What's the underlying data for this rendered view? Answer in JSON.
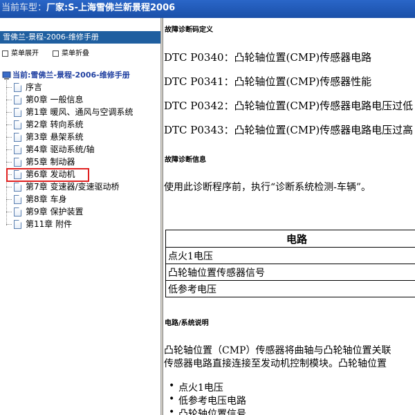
{
  "window": {
    "title_prefix": "当前车型：",
    "title_value": "厂家:S-上海雪佛兰新景程2006"
  },
  "sidebar": {
    "book_title": "雪佛兰-景程-2006-维修手册",
    "expand_label": "菜单展开",
    "collapse_label": "菜单折叠",
    "root_label": "当前:雪佛兰-景程-2006-维修手册",
    "items": [
      {
        "label": "序言"
      },
      {
        "label": "第0章  一般信息"
      },
      {
        "label": "第1章  暖风、通风与空调系统"
      },
      {
        "label": "第2章  转向系统"
      },
      {
        "label": "第3章  悬架系统"
      },
      {
        "label": "第4章  驱动系统/轴"
      },
      {
        "label": "第5章  制动器"
      },
      {
        "label": "第6章  发动机",
        "selected": true
      },
      {
        "label": "第7章  变速器/变速驱动桥"
      },
      {
        "label": "第8章  车身"
      },
      {
        "label": "第9章  保护装置"
      },
      {
        "label": "第11章  附件"
      }
    ]
  },
  "content": {
    "top_heading": "故障诊断码定义",
    "dtcs": [
      "DTC P0340：凸轮轴位置(CMP)传感器电路",
      "DTC P0341：凸轮轴位置(CMP)传感器性能",
      "DTC P0342：凸轮轴位置(CMP)传感器电路电压过低",
      "DTC P0343：凸轮轴位置(CMP)传感器电路电压过高"
    ],
    "diag_heading": "故障诊断信息",
    "diag_text": "使用此诊断程序前，执行“诊断系统检测-车辆”。",
    "table": {
      "header": "电路",
      "rows": [
        "点火1电压",
        "凸轮轴位置传感器信号",
        "低参考电压"
      ]
    },
    "circuit_heading": "电路/系统说明",
    "circuit_line1": "凸轮轴位置（CMP）传感器将曲轴与凸轮轴位置关联",
    "circuit_line2": "传感器电路直接连接至发动机控制模块。凸轮轴位置",
    "bullets": [
      "点火1电压",
      "低参考电压电路",
      "凸轮轴位置信号"
    ]
  },
  "colors": {
    "titlebar": "#1a4fa8",
    "book_header": "#1f5fa0",
    "selection_border": "#e02020"
  }
}
